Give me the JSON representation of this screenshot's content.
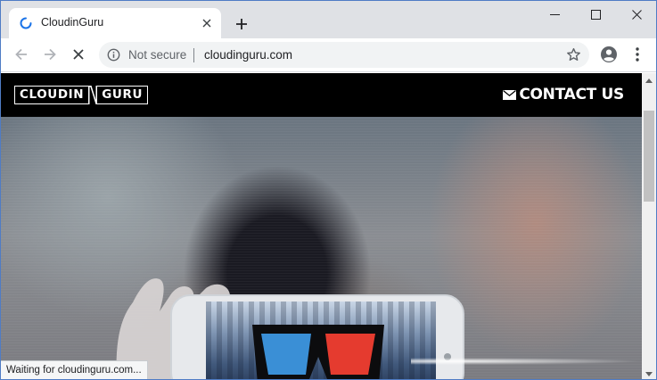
{
  "browser": {
    "tab": {
      "title": "CloudinGuru",
      "spinner_icon": "loading-spinner-icon",
      "close_icon": "close-icon"
    },
    "new_tab_icon": "plus-icon",
    "window_controls": [
      "minimize-icon",
      "maximize-icon",
      "close-icon"
    ],
    "toolbar": {
      "back_icon": "arrow-left-icon",
      "forward_icon": "arrow-right-icon",
      "stop_icon": "stop-loading-icon",
      "security_label": "Not secure",
      "url": "cloudinguru.com",
      "bookmark_icon": "star-icon",
      "profile_icon": "account-icon",
      "menu_icon": "more-vertical-icon"
    },
    "status_text": "Waiting for cloudinguru.com...",
    "accent_color": "#1a73e8"
  },
  "page": {
    "logo": {
      "left": "CLOUDIN",
      "right": "GURU"
    },
    "contact": {
      "label": "CONTACT US",
      "icon": "envelope-icon"
    },
    "hero": {
      "image": "person-holding-phone-3d-glasses"
    }
  }
}
